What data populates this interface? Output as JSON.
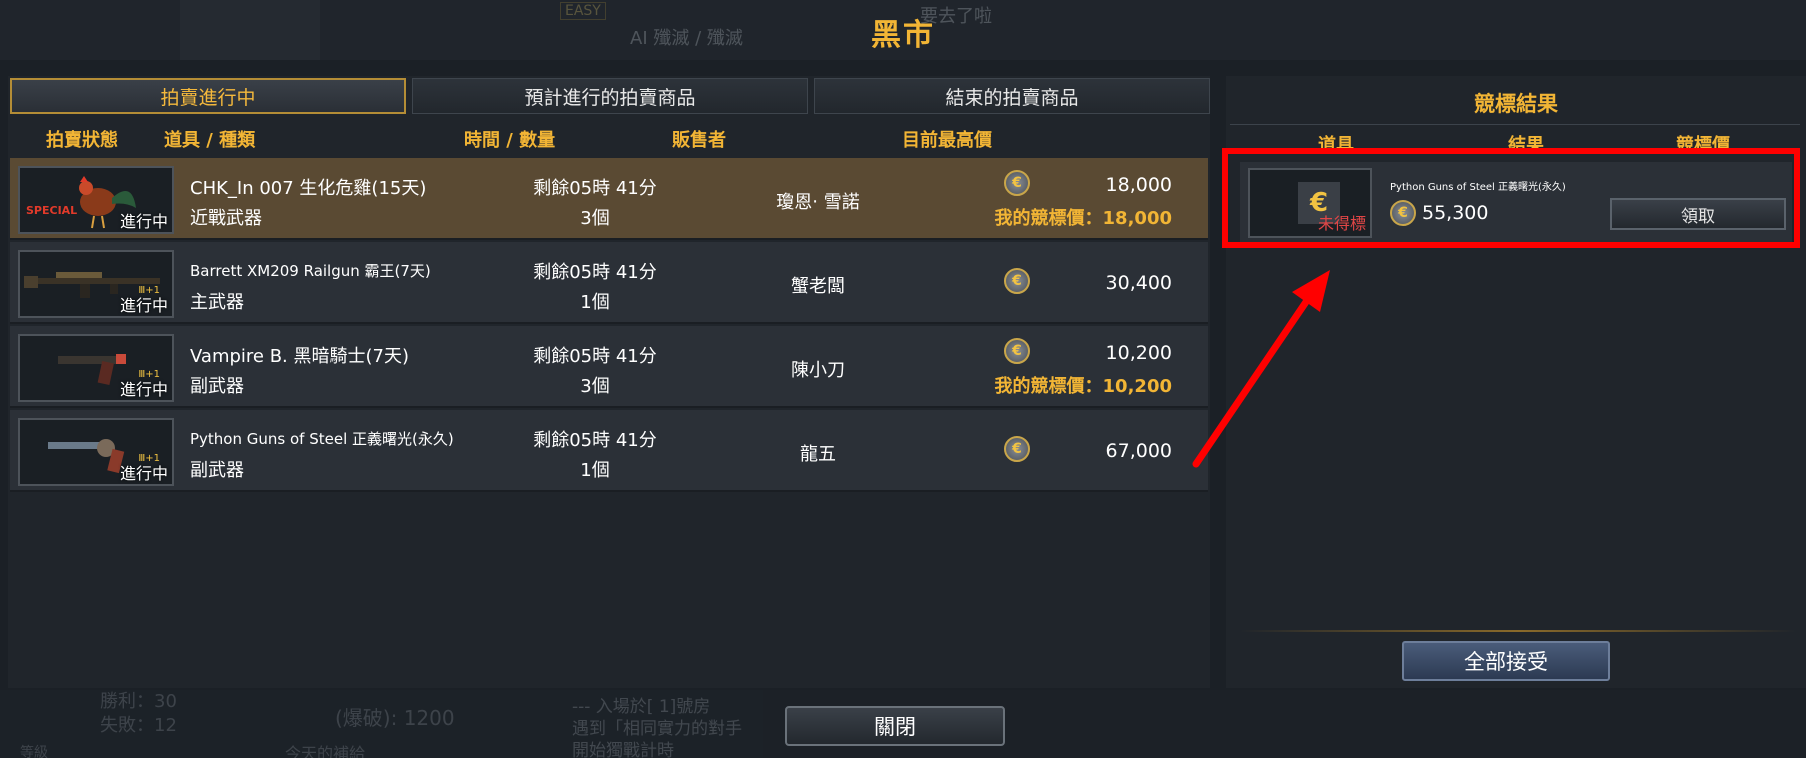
{
  "window": {
    "title": "黑市"
  },
  "background": {
    "difficulty": "EASY",
    "mode": "AI 殲滅 / 殲滅",
    "message": "要去了啦",
    "stats": [
      "勝利：30",
      "失敗：12"
    ],
    "blast": "(爆破): 1200",
    "chat": [
      "--- 入場於[ 1]號房",
      "遇到「相同實力的對手",
      "開始獨戰計時"
    ],
    "level": "等級",
    "supply": "今天的補給"
  },
  "tabs": [
    {
      "label": "拍賣進行中",
      "active": true
    },
    {
      "label": "預計進行的拍賣商品",
      "active": false
    },
    {
      "label": "結束的拍賣商品",
      "active": false
    }
  ],
  "columns": {
    "status": "拍賣狀態",
    "item": "道具 / 種類",
    "time": "時間 / 數量",
    "seller": "販售者",
    "price": "目前最高價"
  },
  "rows": [
    {
      "name": "CHK_In 007 生化危雞(15天)",
      "type": "近戰武器",
      "time": "剩餘05時 41分",
      "qty": "3個",
      "seller": "瓊恩‧ 雪諾",
      "price": "18,000",
      "my_bid": "我的競標價：18,000",
      "status": "進行中",
      "badge": "SPECIAL",
      "icon": "rooster-icon"
    },
    {
      "name": "Barrett XM209 Railgun 霸王(7天)",
      "type": "主武器",
      "time": "剩餘05時 41分",
      "qty": "1個",
      "seller": "蟹老闆",
      "price": "30,400",
      "my_bid": "",
      "status": "進行中",
      "ammo": "Ⅲ+1",
      "icon": "rifle-icon"
    },
    {
      "name": "Vampire B. 黑暗騎士(7天)",
      "type": "副武器",
      "time": "剩餘05時 41分",
      "qty": "3個",
      "seller": "陳小刀",
      "price": "10,200",
      "my_bid": "我的競標價：10,200",
      "status": "進行中",
      "ammo": "Ⅲ+1",
      "icon": "pistol-icon"
    },
    {
      "name": "Python Guns of Steel 正義曙光(永久)",
      "type": "副武器",
      "time": "剩餘05時 41分",
      "qty": "1個",
      "seller": "龍五",
      "price": "67,000",
      "my_bid": "",
      "status": "進行中",
      "ammo": "Ⅲ+1",
      "icon": "revolver-icon"
    }
  ],
  "results": {
    "title": "競標結果",
    "columns": {
      "item": "道具",
      "result": "結果",
      "price": "競標價"
    },
    "items": [
      {
        "name": "Python Guns of Steel 正義曙光(永久)",
        "price": "55,300",
        "result": "未得標",
        "claim_label": "領取",
        "icon": "coin-icon"
      }
    ],
    "accept_all": "全部接受"
  },
  "close_label": "關閉",
  "coin_symbol": "€",
  "colors": {
    "accent": "#f2b535",
    "highlight_row": "#5a4a33",
    "annotation": "#ff0000",
    "fail_text": "#e24646"
  }
}
